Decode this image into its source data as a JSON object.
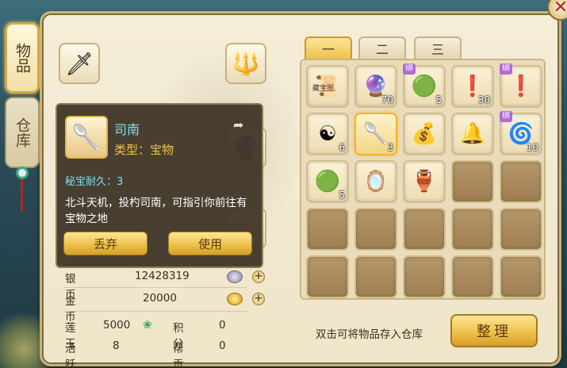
{
  "side_tabs": [
    {
      "label": "物品",
      "active": true
    },
    {
      "label": "仓库",
      "active": false
    }
  ],
  "close_label": "✕",
  "equip_slots": [
    {
      "name": "red-daggers",
      "glyph": "🗡"
    },
    {
      "name": "golden-scepter",
      "glyph": "🔱"
    },
    {
      "name": "purple-orb-slot",
      "glyph": "🔮"
    },
    {
      "name": "empty-slot-a",
      "glyph": ""
    }
  ],
  "tooltip": {
    "item_name": "司南",
    "type_label": "类型：宝物",
    "durability": "秘宝耐久：3",
    "description": "北斗天机，投杓司南，可指引你前往有宝物之地",
    "discard_label": "丢弃",
    "use_label": "使用"
  },
  "stats": {
    "silver_label": "银币",
    "silver_value": "12428319",
    "gold_label": "金币",
    "gold_value": "20000",
    "lianyu_label": "莲玉",
    "lianyu_value": "5000",
    "jifen_label": "积分",
    "jifen_value": "0",
    "huoyue_label": "活跃",
    "huoyue_value": "8",
    "banggong_label": "帮贡",
    "banggong_value": "0"
  },
  "bag_tabs": [
    "一",
    "二",
    "三"
  ],
  "bag_items": [
    {
      "glyph": "📜",
      "text": "藏宝图",
      "count": "",
      "bound": false
    },
    {
      "glyph": "🔮",
      "text": "",
      "count": "70",
      "bound": false
    },
    {
      "glyph": "🟢",
      "text": "",
      "count": "5",
      "bound": true
    },
    {
      "glyph": "❗",
      "text": "",
      "count": "30",
      "bound": false
    },
    {
      "glyph": "❗",
      "text": "",
      "count": "",
      "bound": true
    },
    {
      "glyph": "☯",
      "text": "",
      "count": "6",
      "bound": false
    },
    {
      "glyph": "🥄",
      "text": "",
      "count": "3",
      "bound": false,
      "selected": true
    },
    {
      "glyph": "💰",
      "text": "",
      "count": "",
      "bound": false
    },
    {
      "glyph": "🔔",
      "text": "",
      "count": "",
      "bound": false
    },
    {
      "glyph": "🌀",
      "text": "",
      "count": "10",
      "bound": true
    },
    {
      "glyph": "🟢",
      "text": "",
      "count": "5",
      "bound": false
    },
    {
      "glyph": "🪞",
      "text": "",
      "count": "",
      "bound": false
    },
    {
      "glyph": "🏺",
      "text": "",
      "count": "",
      "bound": false
    }
  ],
  "bound_label": "绑",
  "hint": "双击可将物品存入仓库",
  "sort_label": "整理"
}
